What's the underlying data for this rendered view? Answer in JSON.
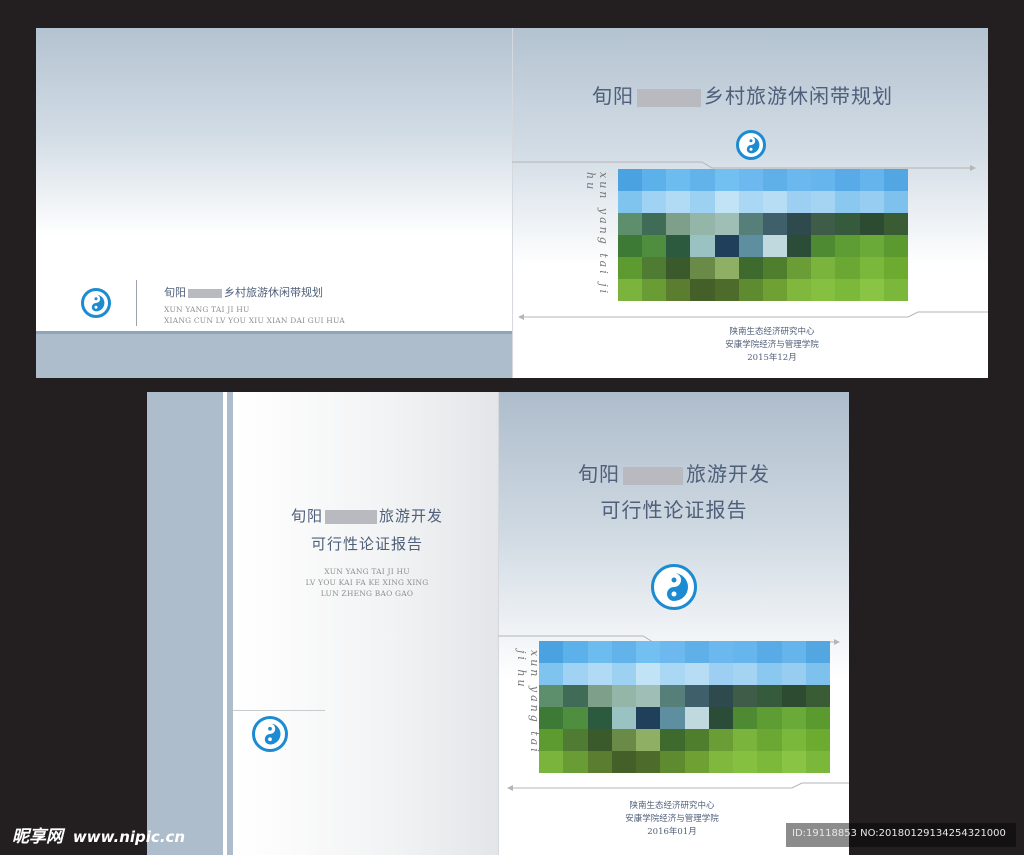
{
  "cover_top": {
    "back": {
      "title_prefix": "旬阳",
      "title_suffix": "乡村旅游休闲带规划",
      "en_line1": "XUN YANG TAI JI HU",
      "en_line2": "XIANG CUN LV YOU XIU XIAN DAI GUI HUA"
    },
    "front": {
      "title_prefix": "旬阳",
      "title_suffix": "乡村旅游休闲带规划",
      "vertical_text": "xun yang tai ji hu",
      "org1": "陕南生态经济研究中心",
      "org2": "安康学院经济与管理学院",
      "date": "2015年12月"
    }
  },
  "cover_bottom": {
    "back": {
      "title_prefix": "旬阳",
      "title_suffix": "旅游开发",
      "title_line2": "可行性论证报告",
      "en_line1": "XUN YANG TAI JI HU",
      "en_line2": "LV YOU KAI FA KE XING XING",
      "en_line3": "LUN ZHENG BAO GAO"
    },
    "front": {
      "title_prefix": "旬阳",
      "title_suffix": "旅游开发",
      "title_line2": "可行性论证报告",
      "vertical_text": "xun yang tai ji hu",
      "org1": "陕南生态经济研究中心",
      "org2": "安康学院经济与管理学院",
      "date": "2016年01月"
    }
  },
  "watermark": {
    "brand": "昵享网",
    "site": "www.nipic.cn",
    "id_text": "ID:19118853 NO:20180129134254321000"
  },
  "colors": {
    "logo_blue": "#1d8bd1",
    "title": "#4f5f79",
    "band": "#aebdcc"
  }
}
